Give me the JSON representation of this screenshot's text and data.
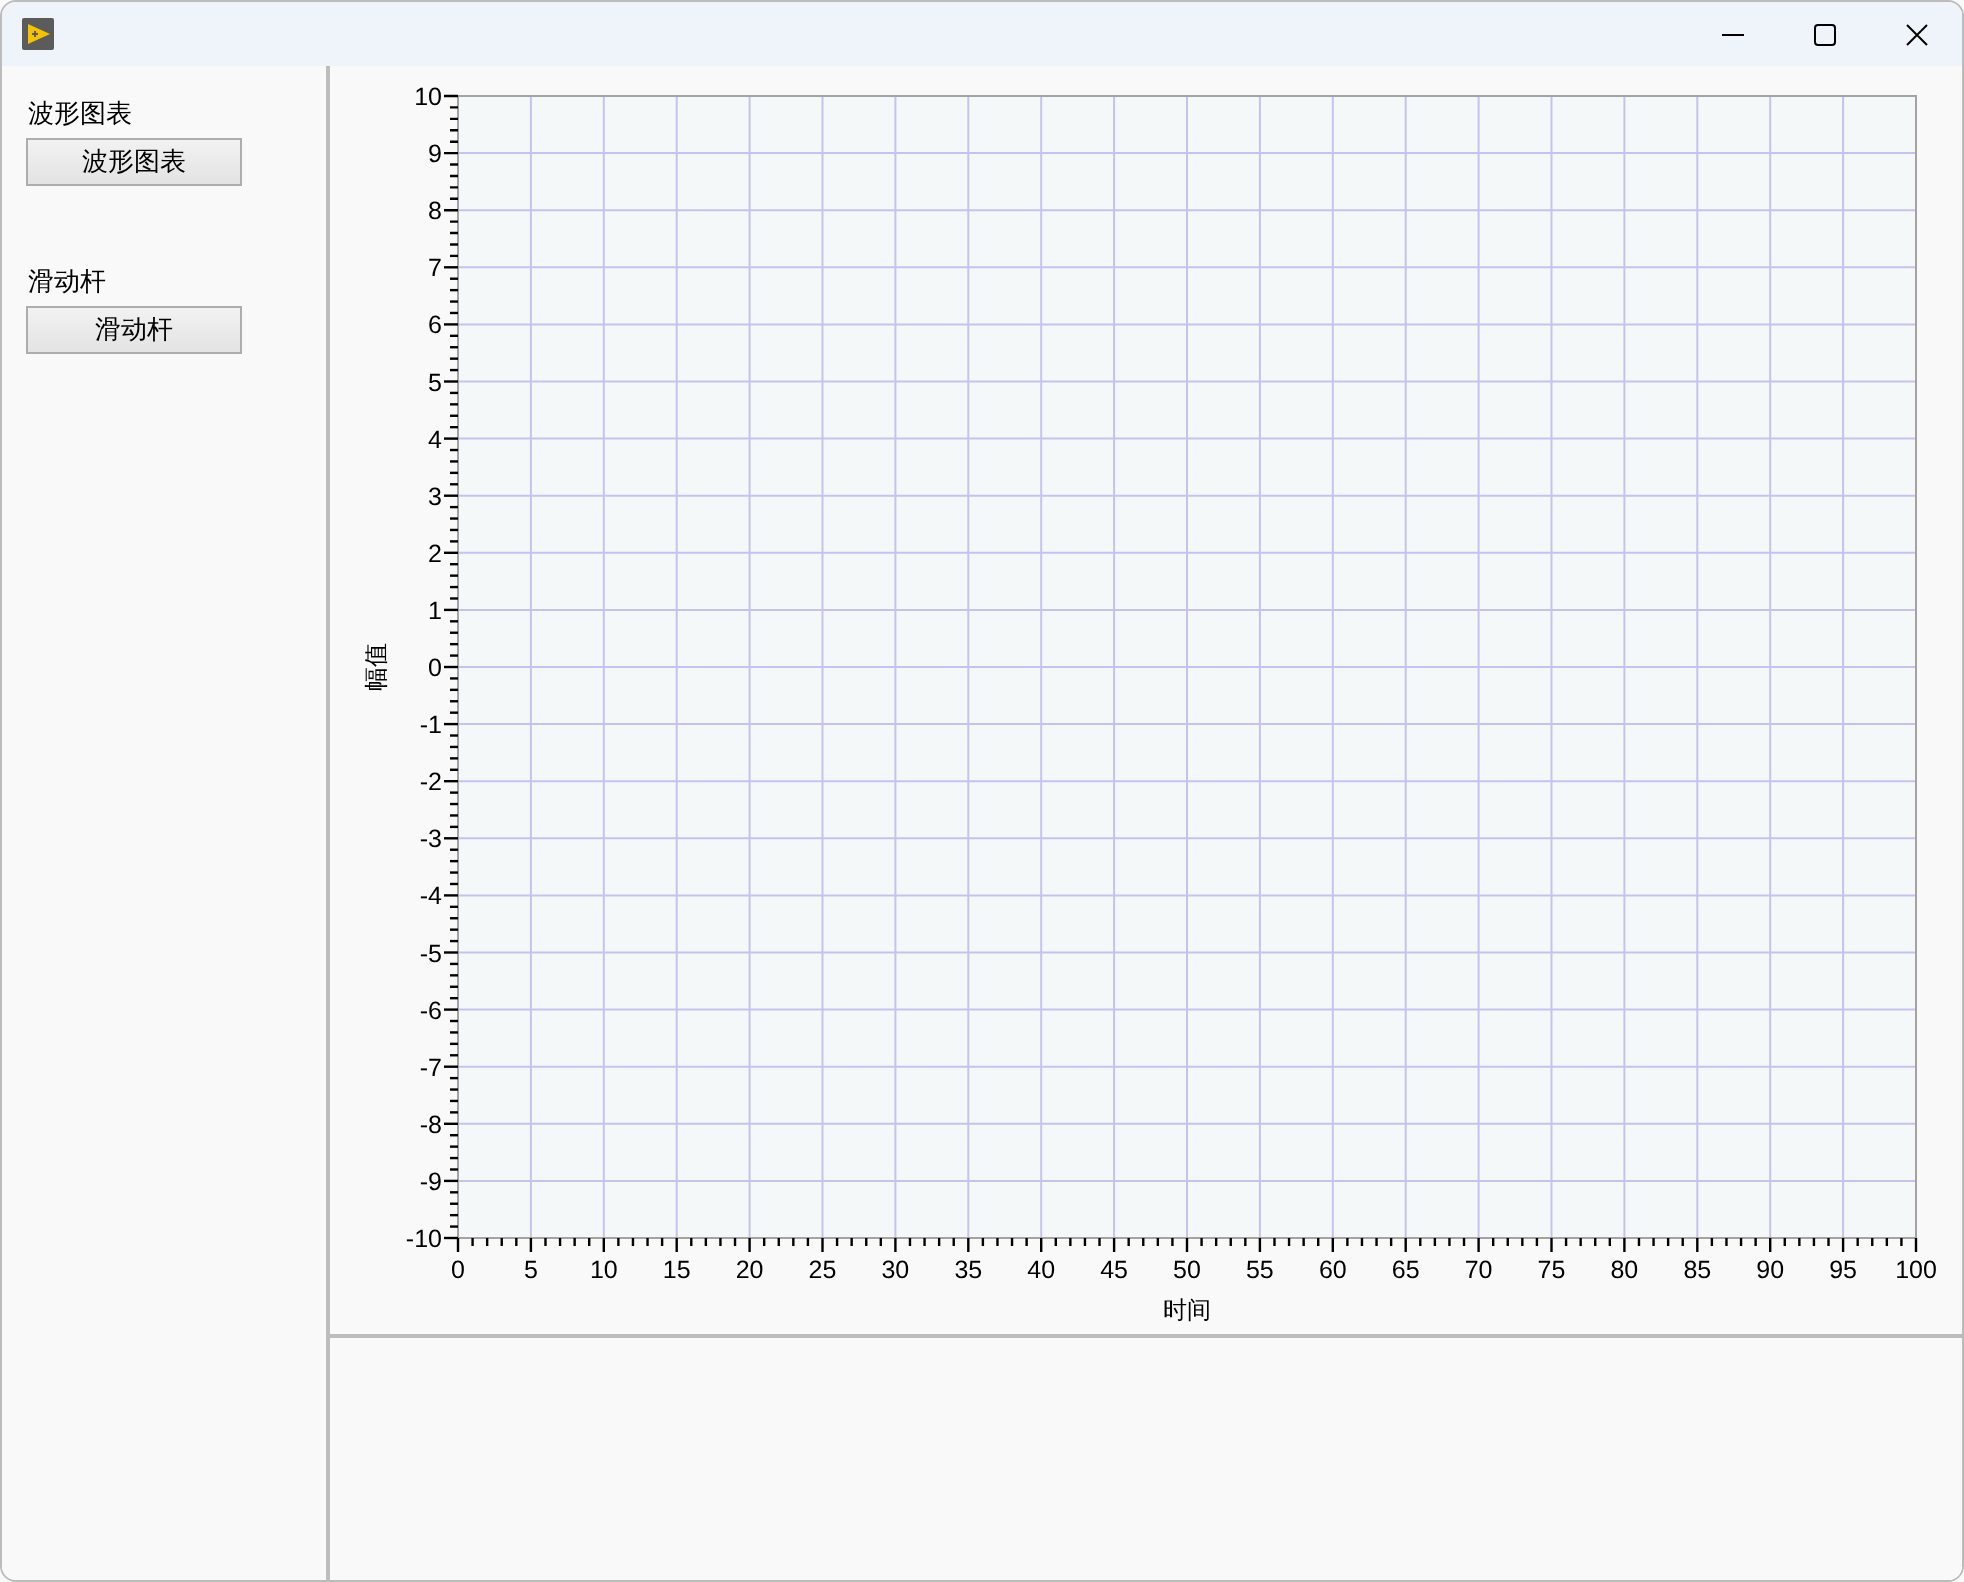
{
  "controls": [
    {
      "label": "波形图表",
      "button": "波形图表"
    },
    {
      "label": "滑动杆",
      "button": "滑动杆"
    }
  ],
  "chart": {
    "chart_data": {
      "type": "line",
      "grid": true,
      "xlabel": "时间",
      "ylabel": "幅值",
      "xlim": [
        0,
        100
      ],
      "ylim": [
        -10,
        10
      ],
      "xticks": [
        0,
        5,
        10,
        15,
        20,
        25,
        30,
        35,
        40,
        45,
        50,
        55,
        60,
        65,
        70,
        75,
        80,
        85,
        90,
        95,
        100
      ],
      "yticks": [
        -10,
        -9,
        -8,
        -7,
        -6,
        -5,
        -4,
        -3,
        -2,
        -1,
        0,
        1,
        2,
        3,
        4,
        5,
        6,
        7,
        8,
        9,
        10
      ]
    }
  }
}
